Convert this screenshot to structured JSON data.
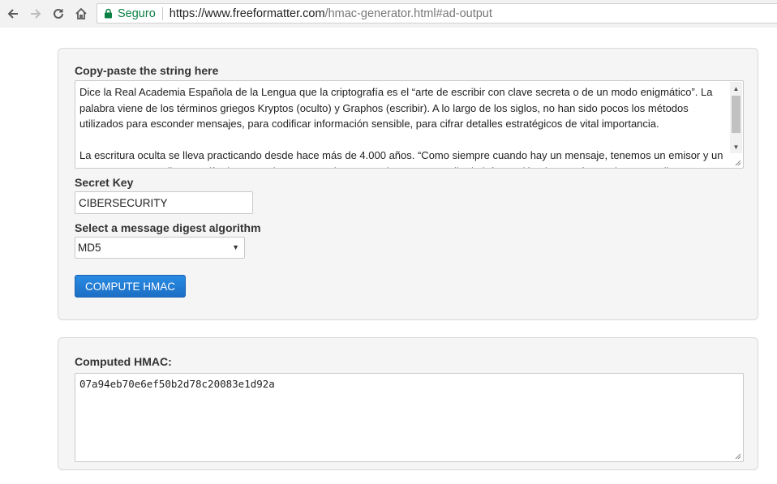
{
  "browser": {
    "secure_label": "Seguro",
    "url_host": "https://www.freeformatter.com",
    "url_path": "/hmac-generator.html#ad-output",
    "icons": [
      "back-arrow-icon",
      "forward-arrow-icon",
      "reload-icon",
      "home-icon",
      "lock-icon"
    ]
  },
  "form": {
    "input_label": "Copy-paste the string here",
    "input_text": "Dice la Real Academia Española de la Lengua que la criptografía es el “arte de escribir con clave secreta o de un modo enigmático”. La palabra viene de los términos griegos Kryptos (oculto) y Graphos (escribir). A lo largo de los siglos, no han sido pocos los métodos utilizados para esconder mensajes, para codificar información sensible, para cifrar detalles estratégicos de vital importancia.\n\nLa escritura oculta se lleva practicando desde hace más de 4.000 años. “Como siempre cuando hay un mensaje, tenemos un emisor y un receptor. Y, entre ellos, un cifrado que se hace para evitar que un interceptor reciba la información sin que tú no quieras”, explica Pura",
    "secret_label": "Secret Key",
    "secret_value": "CIBERSECURITY",
    "algorithm_label": "Select a message digest algorithm",
    "algorithm_value": "MD5",
    "compute_button": "COMPUTE HMAC"
  },
  "output": {
    "label": "Computed HMAC:",
    "value": "07a94eb70e6ef50b2d78c20083e1d92a"
  },
  "colors": {
    "secure_green": "#0b8043",
    "button_blue": "#1c6fc5"
  }
}
